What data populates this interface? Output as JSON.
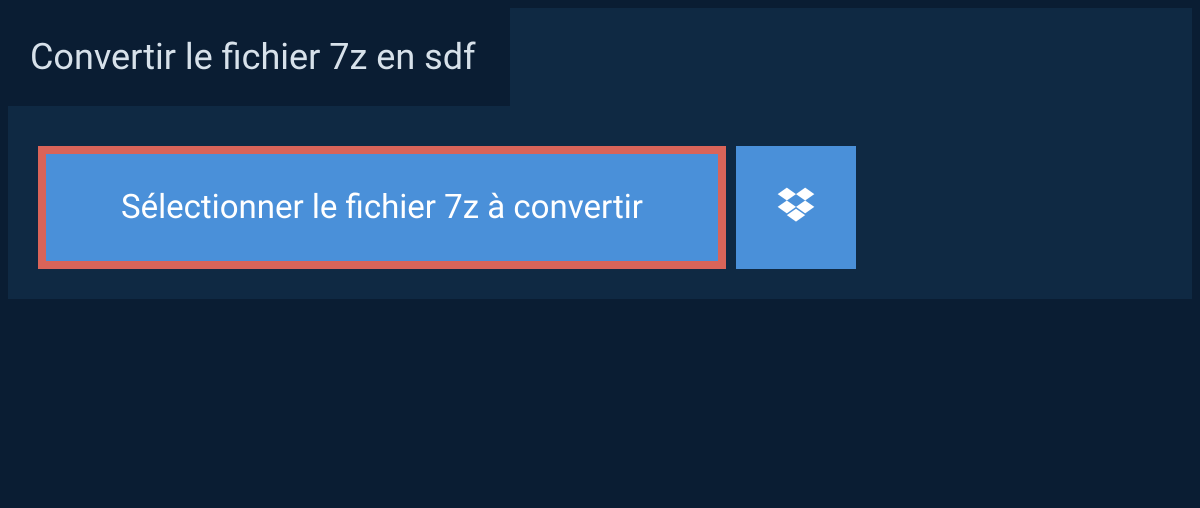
{
  "header": {
    "title": "Convertir le fichier 7z en sdf"
  },
  "actions": {
    "select_file_label": "Sélectionner le fichier 7z à convertir"
  }
}
